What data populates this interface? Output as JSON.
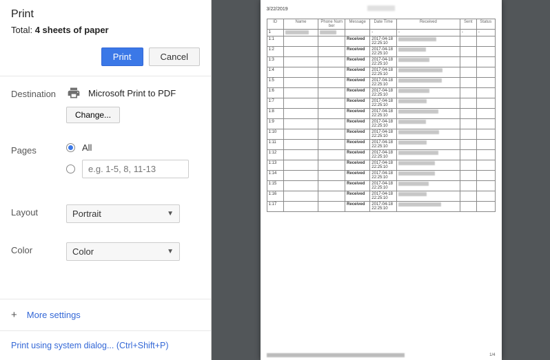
{
  "header": {
    "title": "Print",
    "total_prefix": "Total: ",
    "total_bold": "4 sheets of paper",
    "print_btn": "Print",
    "cancel_btn": "Cancel"
  },
  "destination": {
    "label": "Destination",
    "printer": "Microsoft Print to PDF",
    "change_btn": "Change..."
  },
  "pages": {
    "label": "Pages",
    "all_label": "All",
    "range_placeholder": "e.g. 1-5, 8, 11-13"
  },
  "layout": {
    "label": "Layout",
    "value": "Portrait"
  },
  "color": {
    "label": "Color",
    "value": "Color"
  },
  "more": {
    "label": "More settings"
  },
  "system": {
    "label": "Print using system dialog... (Ctrl+Shift+P)"
  },
  "preview": {
    "date": "3/22/2019",
    "headers": [
      "ID",
      "Name",
      "Phone Number",
      "Message",
      "Date Time",
      "Received",
      "Sent",
      "Status"
    ],
    "first_row": {
      "id": "1",
      "msg": "",
      "date": "-",
      "sent": "-",
      "status": "-"
    },
    "rows": [
      {
        "id": "1:1",
        "msg": "Received",
        "date": "2017-04-18 22:25:10"
      },
      {
        "id": "1:2",
        "msg": "Received",
        "date": "2017-04-18 22:25:10"
      },
      {
        "id": "1:3",
        "msg": "Received",
        "date": "2017-04-18 22:25:10"
      },
      {
        "id": "1:4",
        "msg": "Received",
        "date": "2017-04-18 22:25:10"
      },
      {
        "id": "1:5",
        "msg": "Received",
        "date": "2017-04-18 22:25:10"
      },
      {
        "id": "1:6",
        "msg": "Received",
        "date": "2017-04-18 22:25:10"
      },
      {
        "id": "1:7",
        "msg": "Received",
        "date": "2017-04-18 22:25:10"
      },
      {
        "id": "1:8",
        "msg": "Received",
        "date": "2017-04-18 22:25:10"
      },
      {
        "id": "1:9",
        "msg": "Received",
        "date": "2017-04-18 22:25:10"
      },
      {
        "id": "1:10",
        "msg": "Received",
        "date": "2017-04-18 22:25:10"
      },
      {
        "id": "1:11",
        "msg": "Received",
        "date": "2017-04-18 22:25:10"
      },
      {
        "id": "1:12",
        "msg": "Received",
        "date": "2017-04-18 22:25:10"
      },
      {
        "id": "1:13",
        "msg": "Received",
        "date": "2017-04-18 22:25:10"
      },
      {
        "id": "1:14",
        "msg": "Received",
        "date": "2017-04-18 22:25:10"
      },
      {
        "id": "1:15",
        "msg": "Received",
        "date": "2017-04-18 22:25:10"
      },
      {
        "id": "1:16",
        "msg": "Received",
        "date": "2017-04-18 22:25:10"
      },
      {
        "id": "1:17",
        "msg": "Received",
        "date": "2017-04-18 22:25:10"
      }
    ],
    "page_num": "1/4"
  }
}
